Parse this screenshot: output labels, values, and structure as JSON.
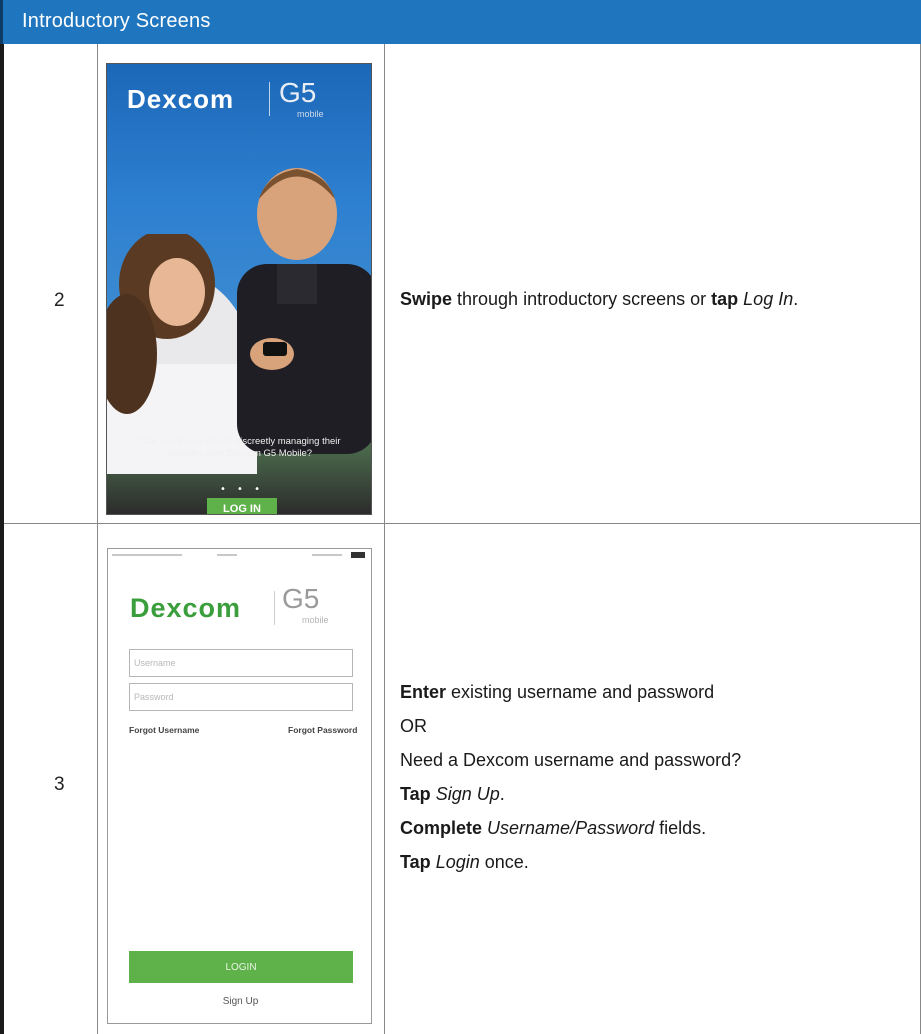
{
  "header": {
    "title": "Introductory Screens"
  },
  "rows": [
    {
      "step": "2",
      "screen": {
        "logo_text": "Dexcom",
        "product": "G5",
        "product_sub": "mobile",
        "caption": "Can you guess who is discreetly managing their diabetes with Dexcom G5 Mobile?",
        "page_dots": "• • • •",
        "login_button": "LOG IN"
      },
      "description": {
        "parts": [
          {
            "text": "Swipe",
            "style": "bold"
          },
          {
            "text": " through introductory screens or ",
            "style": "normal"
          },
          {
            "text": "tap",
            "style": "bold"
          },
          {
            "text": "Log In",
            "style": "italic"
          },
          {
            "text": ".",
            "style": "normal"
          }
        ]
      }
    },
    {
      "step": "3",
      "screen": {
        "logo_text": "Dexcom",
        "product": "G5",
        "product_sub": "mobile",
        "username_placeholder": "Username",
        "password_placeholder": "Password",
        "forgot_username": "Forgot Username",
        "forgot_password": "Forgot Password",
        "login_button": "LOGIN",
        "signup_link": "Sign Up"
      },
      "description": {
        "line1_bold": "Enter",
        "line1_rest": " existing username and password",
        "line2": "OR",
        "line3": "Need a Dexcom username and password?",
        "line4_bold": "Tap",
        "line4_italic": "Sign Up",
        "line4_end": ".",
        "line5_bold": "Complete",
        "line5_italic": "Username/Password",
        "line5_rest": " fields.",
        "line6_bold": "Tap",
        "line6_italic": "Login",
        "line6_rest": " once."
      }
    }
  ]
}
